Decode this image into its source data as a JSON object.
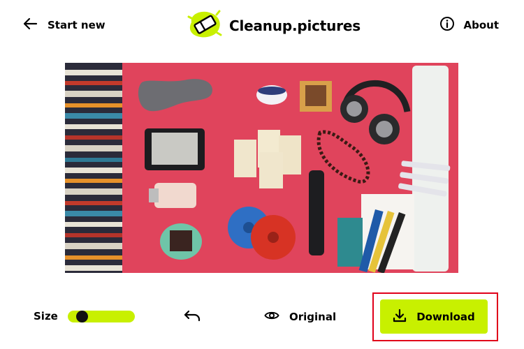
{
  "header": {
    "start_new_label": "Start new",
    "brand_name": "Cleanup.pictures",
    "about_label": "About"
  },
  "toolbar": {
    "size_label": "Size",
    "brush_size_level": 0.15,
    "original_label": "Original",
    "download_label": "Download"
  },
  "colors": {
    "accent": "#c8f000",
    "highlight_frame": "#e0001a",
    "photo_background": "#e0445c"
  },
  "icons": {
    "back": "arrow-left-icon",
    "logo": "eraser-logo-icon",
    "about": "info-icon",
    "undo": "undo-icon",
    "original": "eye-icon",
    "download": "download-icon"
  }
}
